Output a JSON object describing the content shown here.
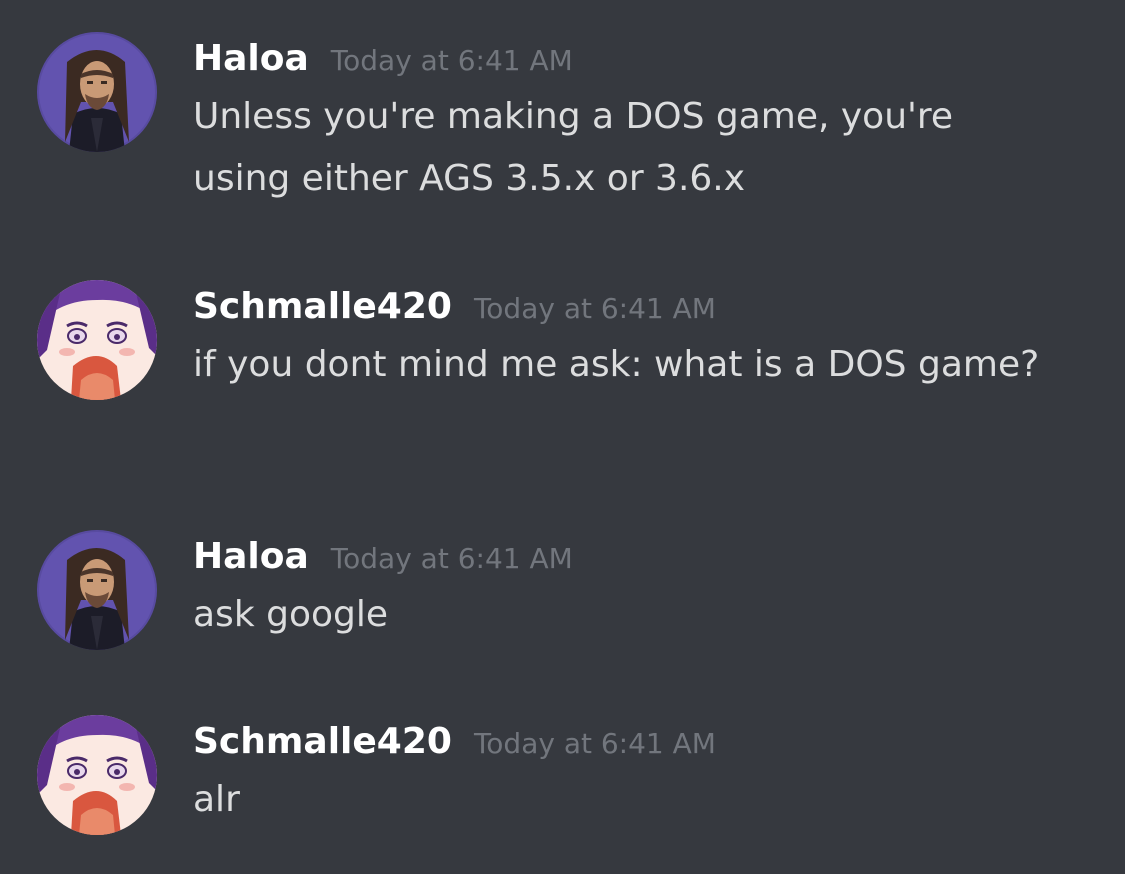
{
  "messages": [
    {
      "username": "Haloa",
      "timestamp": "Today at 6:41 AM",
      "text": "Unless you're making a DOS game, you're using either AGS 3.5.x or 3.6.x",
      "avatar": "haloa-avatar"
    },
    {
      "username": "Schmalle420",
      "timestamp": "Today at 6:41 AM",
      "text": "if you dont mind me ask: what is a DOS game?",
      "avatar": "schmalle420-avatar"
    },
    {
      "username": "Haloa",
      "timestamp": "Today at 6:41 AM",
      "text": "ask google",
      "avatar": "haloa-avatar"
    },
    {
      "username": "Schmalle420",
      "timestamp": "Today at 6:41 AM",
      "text": "alr",
      "avatar": "schmalle420-avatar"
    }
  ],
  "colors": {
    "background": "#36393f",
    "username": "#ffffff",
    "timestamp": "#72767d",
    "message_text": "#dcddde"
  }
}
